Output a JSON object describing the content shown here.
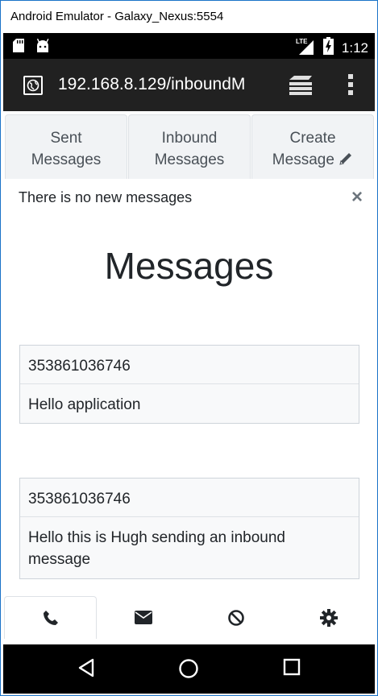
{
  "window": {
    "title": "Android Emulator - Galaxy_Nexus:5554"
  },
  "status_bar": {
    "time": "1:12",
    "network": "LTE"
  },
  "browser": {
    "url": "192.168.8.129/inboundM"
  },
  "tabs": [
    {
      "label_line1": "Sent",
      "label_line2": "Messages"
    },
    {
      "label_line1": "Inbound",
      "label_line2": "Messages"
    },
    {
      "label_line1": "Create",
      "label_line2": "Message"
    }
  ],
  "alert": {
    "text": "There is no new messages",
    "close": "×"
  },
  "page": {
    "title": "Messages"
  },
  "messages": [
    {
      "sender": "353861036746",
      "body": "Hello application"
    },
    {
      "sender": "353861036746",
      "body": "Hello this is Hugh sending an inbound message"
    }
  ],
  "bottom_nav": [
    {
      "icon": "phone-icon"
    },
    {
      "icon": "envelope-icon"
    },
    {
      "icon": "ban-icon"
    },
    {
      "icon": "gear-icon"
    }
  ],
  "colors": {
    "toolbar": "#212121",
    "status_bar": "#000000",
    "text": "#212529",
    "muted": "#495057"
  }
}
